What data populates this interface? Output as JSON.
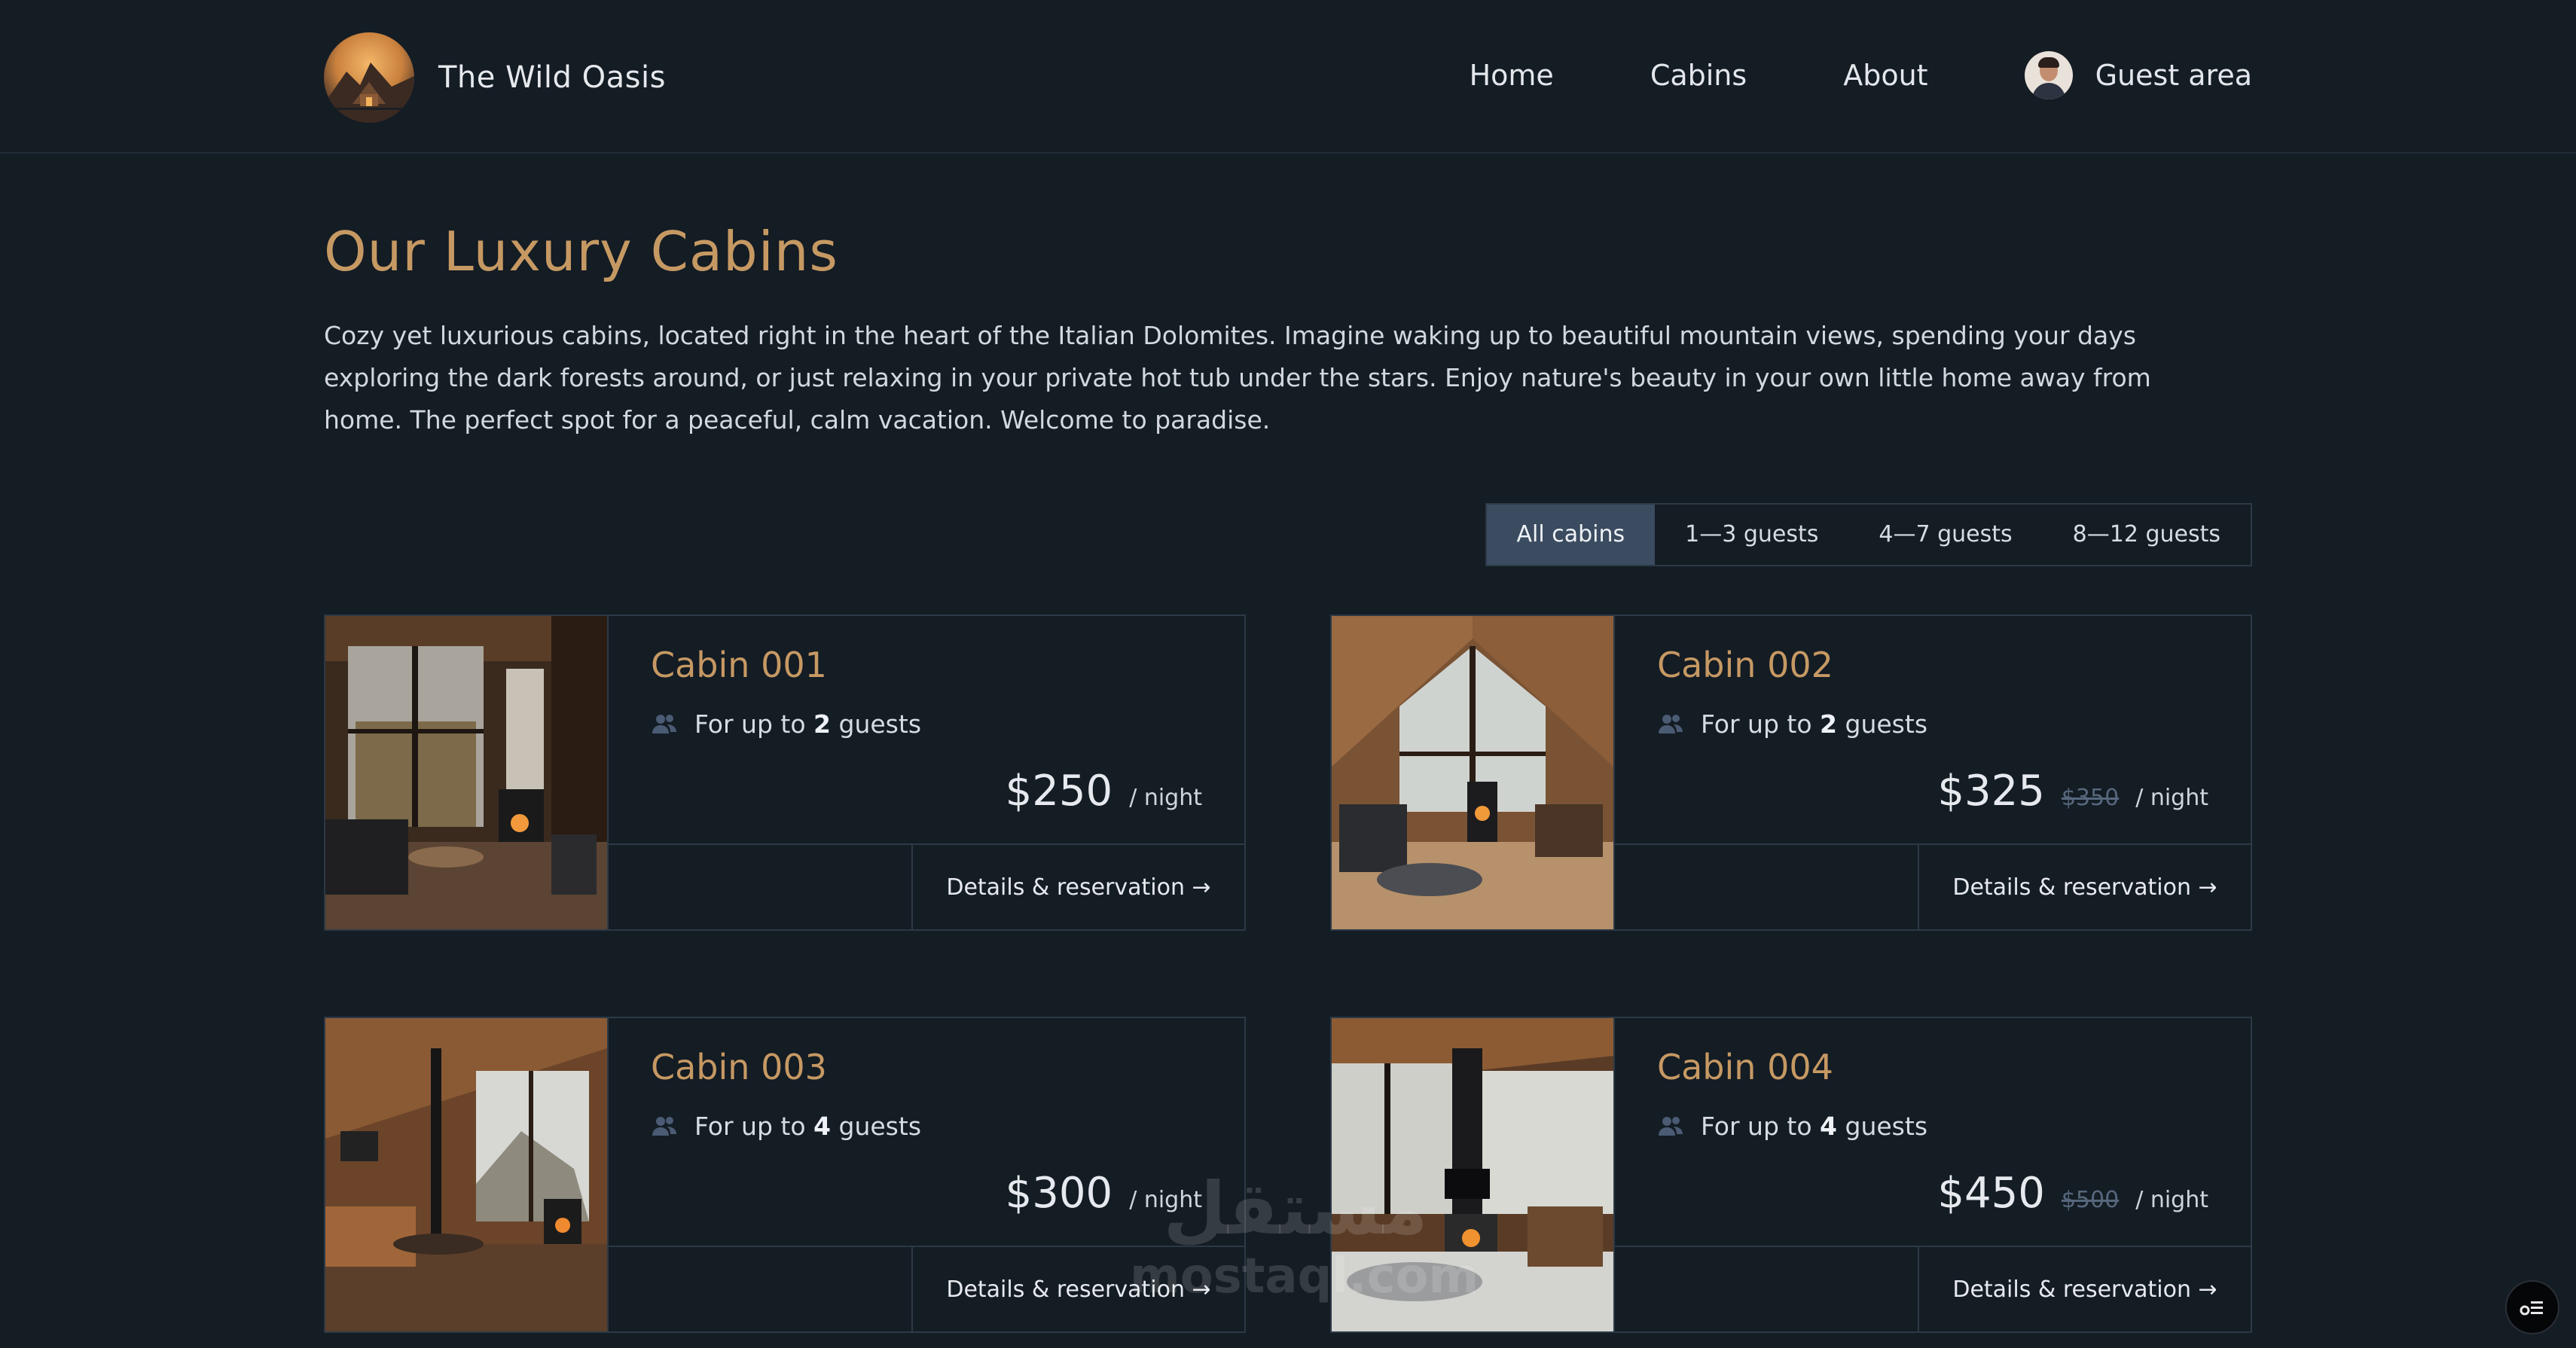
{
  "header": {
    "brand_name": "The Wild Oasis",
    "nav": [
      "Home",
      "Cabins",
      "About"
    ],
    "guest_area": "Guest area"
  },
  "page": {
    "title": "Our Luxury Cabins",
    "intro": "Cozy yet luxurious cabins, located right in the heart of the Italian Dolomites. Imagine waking up to beautiful mountain views, spending your days exploring the dark forests around, or just relaxing in your private hot tub under the stars. Enjoy nature's beauty in your own little home away from home. The perfect spot for a peaceful, calm vacation. Welcome to paradise."
  },
  "filter": {
    "options": [
      "All cabins",
      "1—3 guests",
      "4—7 guests",
      "8—12 guests"
    ],
    "selected": "All cabins"
  },
  "cabins": [
    {
      "name": "Cabin 001",
      "cap_prefix": "For up to",
      "guests": "2",
      "cap_suffix": "guests",
      "price": "$250",
      "old_price": "",
      "unit": "/ night",
      "details": "Details & reservation →"
    },
    {
      "name": "Cabin 002",
      "cap_prefix": "For up to",
      "guests": "2",
      "cap_suffix": "guests",
      "price": "$325",
      "old_price": "$350",
      "unit": "/ night",
      "details": "Details & reservation →"
    },
    {
      "name": "Cabin 003",
      "cap_prefix": "For up to",
      "guests": "4",
      "cap_suffix": "guests",
      "price": "$300",
      "old_price": "",
      "unit": "/ night",
      "details": "Details & reservation →"
    },
    {
      "name": "Cabin 004",
      "cap_prefix": "For up to",
      "guests": "4",
      "cap_suffix": "guests",
      "price": "$450",
      "old_price": "$500",
      "unit": "/ night",
      "details": "Details & reservation →"
    }
  ],
  "watermark": {
    "arabic": "مستقل",
    "latin": "mostaql.com"
  },
  "colors": {
    "background": "#141c24",
    "accent": "#c69963",
    "filter_active": "#3b4b60",
    "border": "#2c3946"
  }
}
